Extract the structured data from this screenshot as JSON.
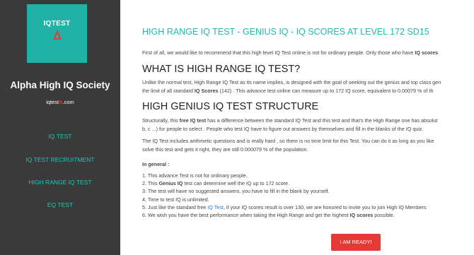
{
  "sidebar": {
    "logo_text": "IQTEST",
    "society": "Alpha High IQ Society",
    "domain_pre": "iqtest",
    "domain_mid": "A",
    "domain_post": ".com",
    "nav": [
      "IQ TEST",
      "IQ TEST RECRUITMENT",
      "HIGH RANGE IQ TEST",
      "EQ TEST"
    ]
  },
  "main": {
    "title": "HIGH RANGE IQ TEST - GENIUS IQ - IQ SCORES AT LEVEL 172 SD15",
    "intro_pre": "First of all, we would like to recommend that this high level IQ Test online is not for ordinary people. Only those who have ",
    "intro_bold": "IQ scores",
    "h_what": "WHAT IS HIGH RANGE IQ TEST?",
    "what_1": "Unlike the normal test, High Range IQ Test as its name implies, is designed with the goal of seeking out the genius and top class gen",
    "what_2_pre": "the limit of all standard ",
    "what_2_bold": "IQ Scores",
    "what_2_post": " (142) . This advance test online can measure up to 172 IQ score, equivalent to 0.00079 % of th",
    "h_struct": "HIGH GENIUS IQ TEST STRUCTURE",
    "struct_1_pre": "Structurally, this ",
    "struct_1_bold": "free IQ test",
    "struct_1_post": " has a difference between the standard IQ Test and this test and that's the High Range one has absolut",
    "struct_2": "b, c ...) for people to select . People who test IQ have to figure out answers by themselves and fill in the blanks of the IQ quiz.",
    "struct_3": "The IQ Test includes arithmetic questions and is really hard , so there is no time limit for this Test. You can do it as long as you like",
    "struct_4": "solve this test and gets it right, they are still 0.000079 % of the population.",
    "in_general": "In general :",
    "list_1": "1. This advance Test is not for ordinary people.",
    "list_2_pre": "2. This ",
    "list_2_bold": "Genius IQ",
    "list_2_post": " test can determine well the IQ up to 172 score.",
    "list_3": "3. The test will have no suggested answers, you have to fill in the blank by yourself.",
    "list_4": "4. Time to test IQ is unlimited.",
    "list_5_pre": "5. Just like the standard free ",
    "list_5_link": "IQ Test",
    "list_5_post": ", if your IQ scores result is over 130, we are honored to invite you to join High IQ Members",
    "list_6_pre": "6. We wish you have the best performance when taking the High Range and get the highest ",
    "list_6_bold": "IQ scores",
    "list_6_post": " possible.",
    "button": "I AM READY!"
  },
  "colors": {
    "teal": "#22b8ab",
    "sidebar": "#3a3a3a",
    "button": "#e53935",
    "link": "#2a7bd6"
  }
}
